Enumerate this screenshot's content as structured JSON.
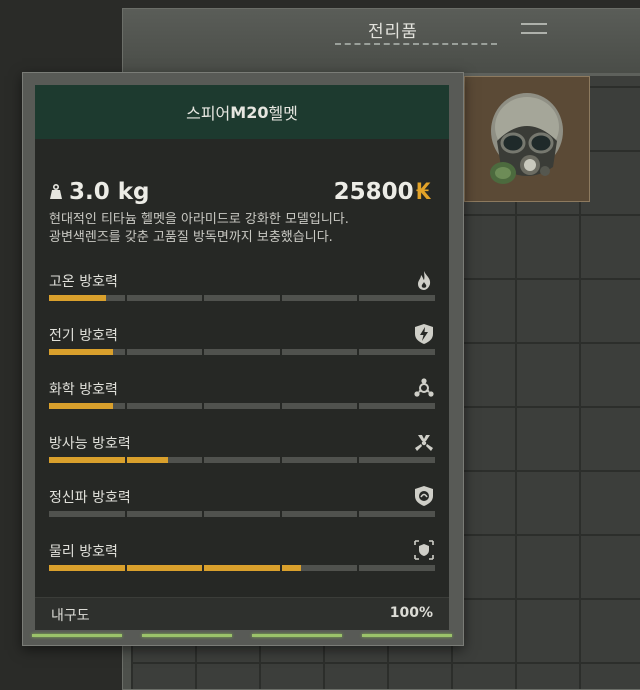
{
  "loot_window": {
    "title": "전리품"
  },
  "tooltip": {
    "item_name_prefix": "스피어 ",
    "item_name_model": "M20",
    "item_name_suffix": " 헬멧",
    "weight": "3.0 kg",
    "price": "25800",
    "price_icon": "₭",
    "description": "현대적인 티타늄 헬멧을 아라미드로 강화한 모델입니다.\n광변색렌즈를 갖춘 고품질 방독면까지 보충했습니다.",
    "stats": [
      {
        "label": "고온 방호력",
        "icon": "fire-icon",
        "value": 0.15
      },
      {
        "label": "전기 방호력",
        "icon": "lightning-shield-icon",
        "value": 0.17
      },
      {
        "label": "화학 방호력",
        "icon": "chemical-icon",
        "value": 0.17
      },
      {
        "label": "방사능 방호력",
        "icon": "radiation-icon",
        "value": 0.31
      },
      {
        "label": "정신파 방호력",
        "icon": "psy-shield-icon",
        "value": 0.0
      },
      {
        "label": "물리 방호력",
        "icon": "armor-icon",
        "value": 0.65
      }
    ],
    "durability_label": "내구도",
    "durability_value": "100%"
  },
  "colors": {
    "accent": "#d9a02c",
    "name_bar": "#1d3a2f",
    "bar_empty": "#50524e",
    "durability_green": "#9bc36a"
  }
}
